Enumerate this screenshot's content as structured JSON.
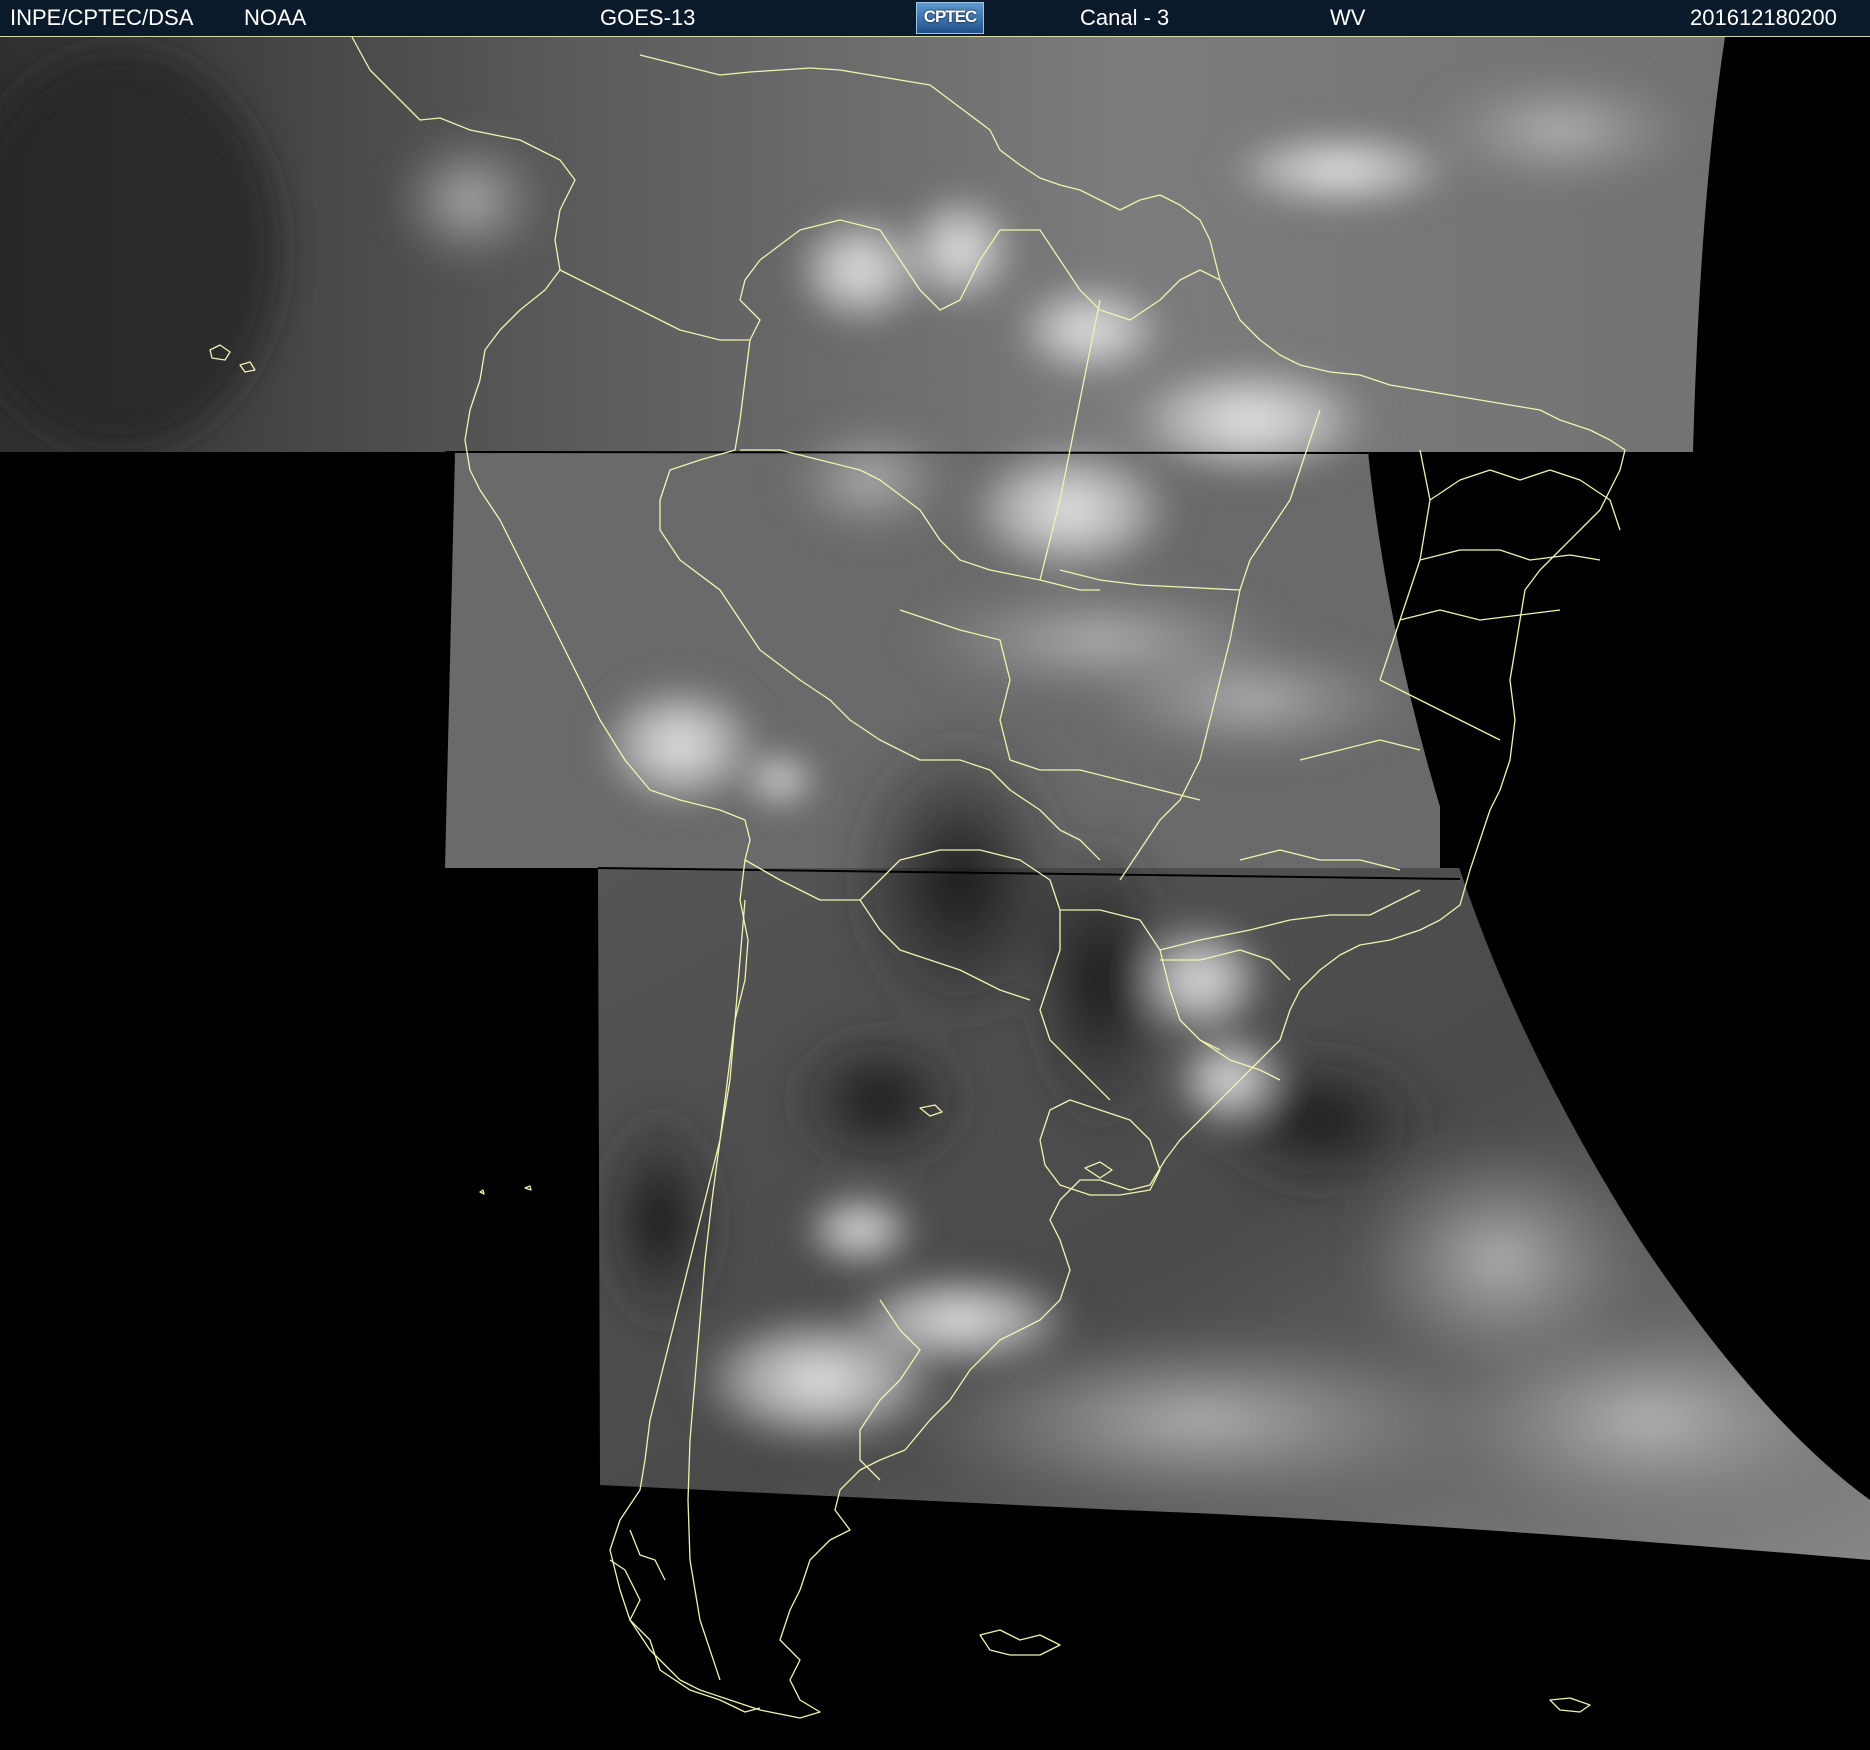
{
  "header": {
    "institution": "INPE/CPTEC/DSA",
    "agency": "NOAA",
    "satellite": "GOES-13",
    "logo_text": "CPTEC",
    "channel": "Canal - 3",
    "band": "WV",
    "timestamp": "201612180200"
  },
  "colors": {
    "header_background": "#0b1a2a",
    "header_text": "#ffffff",
    "coastline": "#f2f2b0",
    "no_data": "#000000"
  },
  "image": {
    "type": "satellite water vapor image",
    "region": "South America"
  }
}
